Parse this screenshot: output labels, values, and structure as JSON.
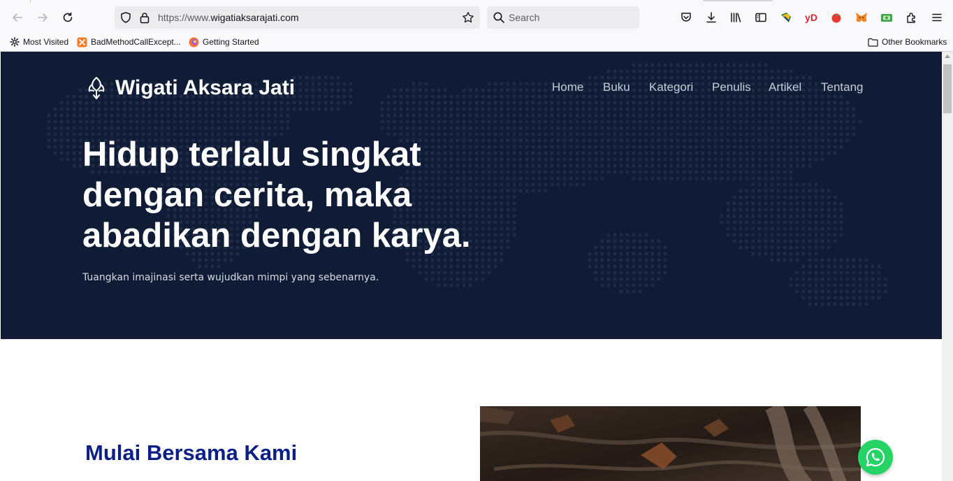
{
  "browser": {
    "url_prefix": "https://www.",
    "url_host": "wigatiaksarajati.com",
    "search_placeholder": "Search",
    "bookmarks": [
      {
        "label": "Most Visited",
        "icon": "gear-icon"
      },
      {
        "label": "BadMethodCallExcept...",
        "icon": "xampp-icon"
      },
      {
        "label": "Getting Started",
        "icon": "firefox-icon"
      }
    ],
    "other_bookmarks": "Other Bookmarks",
    "extensions": [
      "pocket-icon",
      "download-icon",
      "library-icon",
      "reader-view-icon",
      "extension-arrow-icon",
      "yd-icon",
      "tomato-icon",
      "metamask-icon",
      "cash-icon",
      "extensions-icon",
      "menu-icon"
    ],
    "yd_label": "yD"
  },
  "site": {
    "brand": "Wigati Aksara Jati",
    "nav": [
      "Home",
      "Buku",
      "Kategori",
      "Penulis",
      "Artikel",
      "Tentang"
    ],
    "hero": {
      "headline": [
        "Hidup terlalu singkat",
        "dengan cerita, maka",
        "abadikan dengan karya."
      ],
      "subtext": "Tuangkan imajinasi serta wujudkan mimpi yang sebenarnya."
    },
    "section_title": "Mulai Bersama Kami",
    "colors": {
      "hero_bg": "#101c36",
      "section_title": "#0c1f86",
      "whatsapp": "#25d366"
    }
  }
}
